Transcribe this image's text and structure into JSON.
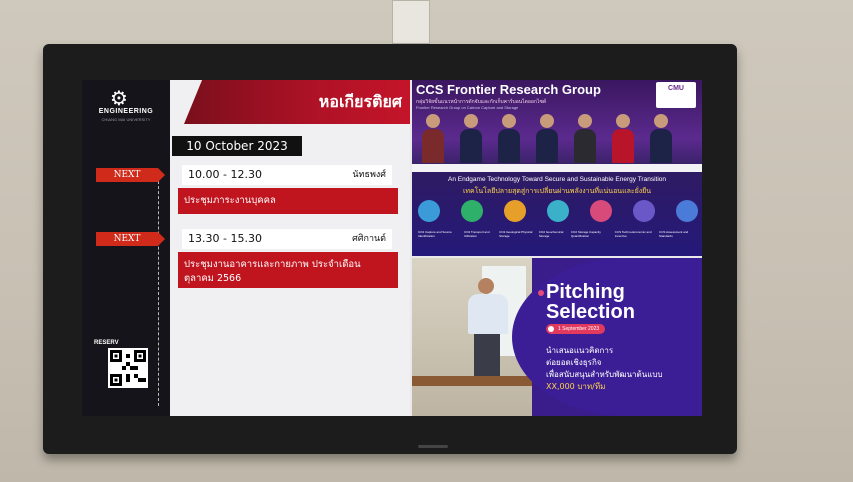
{
  "signage": {
    "logo": "ENGINEERING",
    "logo_sub": "CHIANG MAI UNIVERSITY",
    "room_name": "หอเกียรติยศ",
    "date": "10 October 2023",
    "reserve_label": "RESERV",
    "meetings": [
      {
        "tag": "NEXT",
        "time": "10.00 - 12.30",
        "organizer": "นัทธพงศ์",
        "title": "ประชุมภาระงานบุคคล"
      },
      {
        "tag": "NEXT",
        "time": "13.30 - 15.30",
        "organizer": "ศศิกานต์",
        "title": "ประชุมงานอาคารและกายภาพ ประจำเดือน ตุลาคม 2566"
      }
    ]
  },
  "poster_top": {
    "title": "CCS Frontier Research Group",
    "subtitle": "กลุ่มวิจัยขั้นแนวหน้าการดักจับและกักเก็บคาร์บอนไดออกไซด์",
    "subtitle2": "Frontier Research Group on Carbon Capture and Storage",
    "badge": "CMU",
    "headline": "An Endgame Technology Toward Secure and Sustainable Energy Transition",
    "headline_th": "เทคโนโลยีปลายสุดสู่การเปลี่ยนผ่านพลังงานที่แน่นอนและยั่งยืน",
    "icon_colors": [
      "#3a9bd8",
      "#2fb06a",
      "#e6a02a",
      "#3ab0c9",
      "#d84a7a",
      "#6a58c9",
      "#4a7bd8",
      "#e0c13a"
    ],
    "icon_captions": [
      "CO2 Capture and Source Identification",
      "CO2 Transport and Utilization",
      "CO2 Geological Physical Storage",
      "CO2 Geochemical Storage",
      "CO2 Storage Capacity Quantification",
      "CCS Techno-Economic and Incentive",
      "CCS Assessment and Standards"
    ]
  },
  "poster_bottom": {
    "title_line1": "Pitching",
    "title_line2": "Selection",
    "date": "1 September 2023",
    "lines": [
      "นำเสนอแนวคิดการ",
      "ต่อยอดเชิงธุรกิจ",
      "เพื่อสนับสนุนสำหรับพัฒนาต้นแบบ",
      "XX,000 บาท/ทีม"
    ]
  },
  "colors": {
    "accent_red": "#c0141f",
    "next_orange": "#d02a1a",
    "poster_purple": "#3b1e95"
  }
}
